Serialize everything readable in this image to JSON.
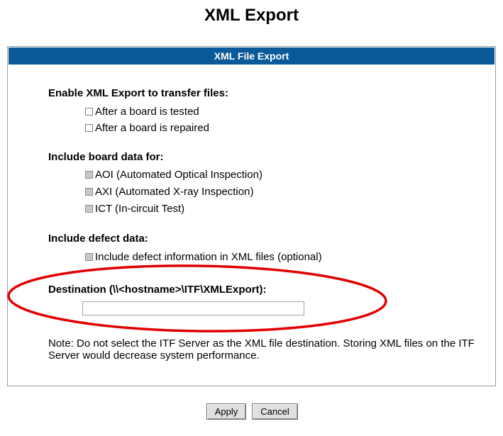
{
  "page": {
    "title": "XML Export"
  },
  "panel": {
    "header": "XML File Export"
  },
  "export_section": {
    "title": "Enable XML Export to transfer files:",
    "options": [
      {
        "label": "After a board is tested",
        "checked": false,
        "enabled": true
      },
      {
        "label": "After a board is repaired",
        "checked": false,
        "enabled": true
      }
    ]
  },
  "board_data_section": {
    "title": "Include board data for:",
    "options": [
      {
        "label": "AOI (Automated Optical Inspection)",
        "checked": false,
        "enabled": false
      },
      {
        "label": "AXI (Automated X-ray Inspection)",
        "checked": false,
        "enabled": false
      },
      {
        "label": "ICT (In-circuit Test)",
        "checked": false,
        "enabled": false
      }
    ]
  },
  "defect_section": {
    "title": "Include defect data:",
    "options": [
      {
        "label": "Include defect information in XML files (optional)",
        "checked": false,
        "enabled": false
      }
    ]
  },
  "destination": {
    "label": "Destination (\\\\<hostname>\\ITF\\XMLExport):",
    "value": "",
    "placeholder": ""
  },
  "note": "Note: Do not select the ITF Server as the XML file destination. Storing XML files on the ITF Server would decrease system performance.",
  "buttons": {
    "apply": "Apply",
    "cancel": "Cancel"
  },
  "colors": {
    "header_bg": "#0a5a99",
    "highlight_oval": "#e00000"
  }
}
